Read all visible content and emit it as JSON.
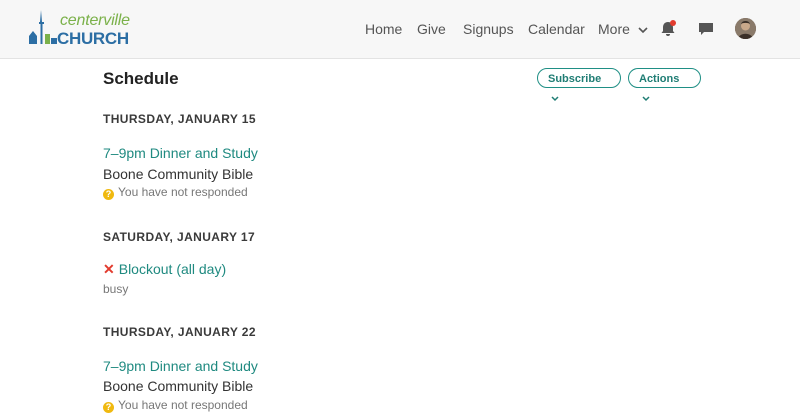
{
  "logo": {
    "line1": "centerville",
    "line2": "CHURCH"
  },
  "nav": {
    "home": "Home",
    "give": "Give",
    "signups": "Signups",
    "calendar": "Calendar",
    "more": "More"
  },
  "colors": {
    "accent": "#1f8a80",
    "logo_green": "#7bb14a",
    "logo_blue": "#2c6ea4",
    "notification_dot": "#e23b2e",
    "warning": "#f0b90f",
    "decline": "#e23b2e"
  },
  "icons": {
    "bell": "bell-icon",
    "chat": "chat-icon",
    "question": "question-circle-icon",
    "decline": "x-icon",
    "chevron": "chevron-down-icon"
  },
  "page": {
    "title": "Schedule",
    "subscribe_label": "Subscribe",
    "actions_label": "Actions"
  },
  "schedule": [
    {
      "date": "THURSDAY, JANUARY 15",
      "title": "7–9pm Dinner and Study",
      "location": "Boone Community Bible",
      "status": "You have not responded"
    },
    {
      "date": "SATURDAY, JANUARY 17",
      "title": "Blockout (all day)",
      "status": "busy"
    },
    {
      "date": "THURSDAY, JANUARY 22",
      "title": "7–9pm Dinner and Study",
      "location": "Boone Community Bible",
      "status": "You have not responded"
    }
  ]
}
